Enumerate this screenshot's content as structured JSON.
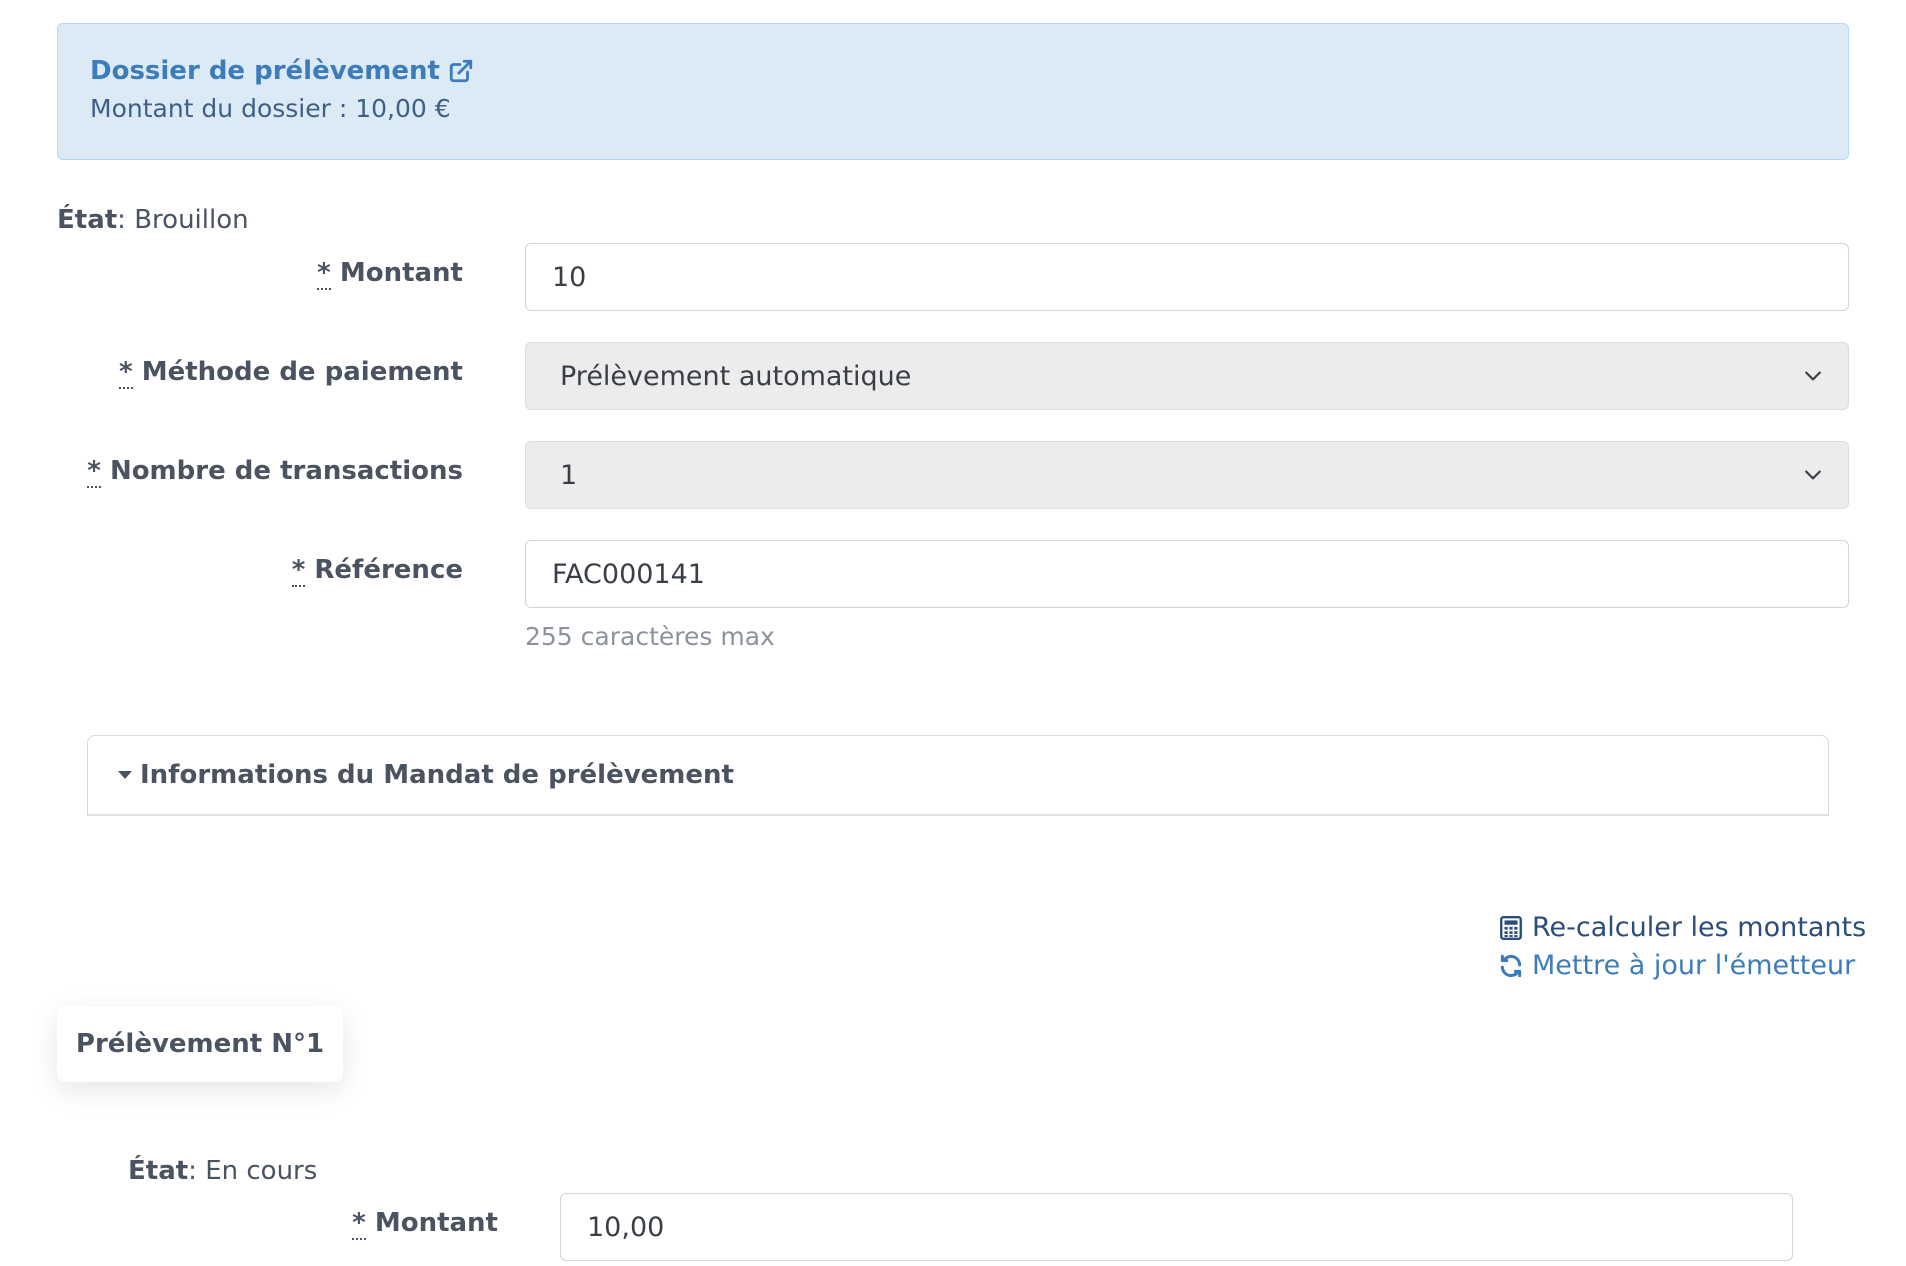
{
  "alert": {
    "link_label": "Dossier de prélèvement",
    "link_icon": "external-link-icon",
    "amount_text": "Montant du dossier : 10,00 €"
  },
  "etat": {
    "label": "État",
    "value": "Brouillon"
  },
  "form": {
    "required_mark": "*",
    "montant": {
      "label": "Montant",
      "value": "10"
    },
    "methode": {
      "label": "Méthode de paiement",
      "value": "Prélèvement automatique"
    },
    "transactions": {
      "label": "Nombre de transactions",
      "value": "1"
    },
    "reference": {
      "label": "Référence",
      "value": "FAC000141",
      "help": "255 caractères max"
    }
  },
  "panel": {
    "title": "Informations du Mandat de prélèvement"
  },
  "actions": {
    "recalc": {
      "label": "Re-calculer les montants",
      "icon": "calculator-icon",
      "color": "#2b4d78"
    },
    "update": {
      "label": "Mettre à jour l'émetteur",
      "icon": "refresh-icon",
      "color": "#3d7cba"
    }
  },
  "tab": {
    "label": "Prélèvement N°1"
  },
  "sub": {
    "etat": {
      "label": "État",
      "value": "En cours"
    },
    "montant": {
      "label": "Montant",
      "value": "10,00"
    }
  }
}
